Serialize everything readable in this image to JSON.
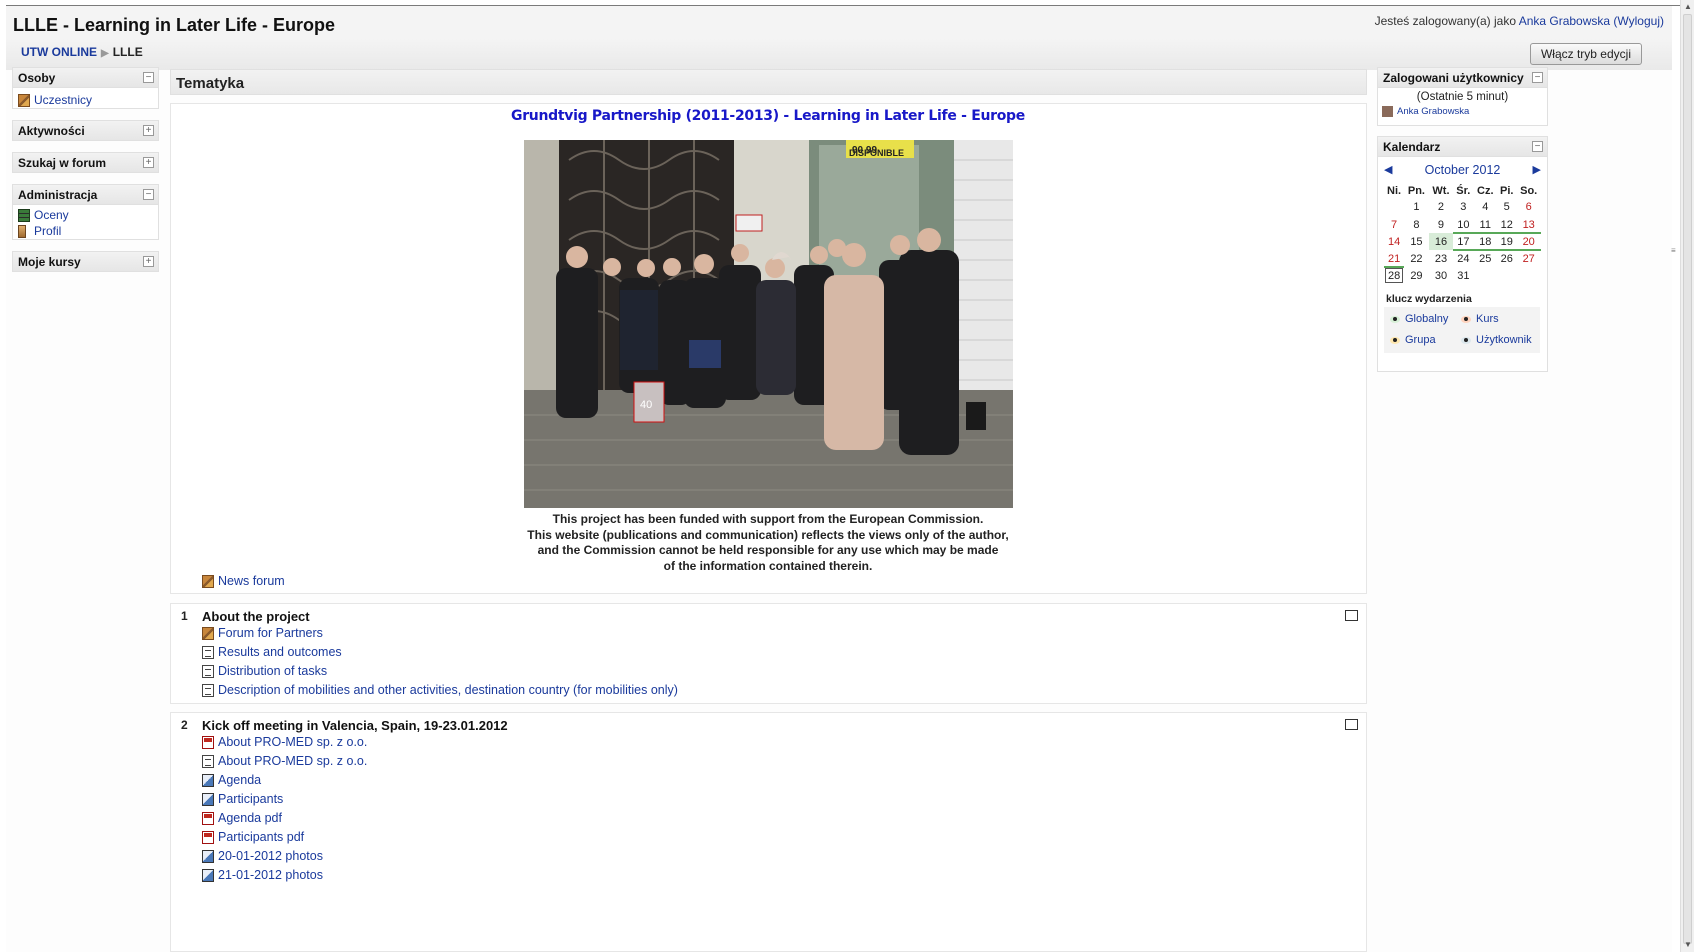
{
  "header": {
    "site_title": "LLLE - Learning in Later Life - Europe",
    "login_prefix": "Jesteś zalogowany(a) jako ",
    "user_name": "Anka Grabowska",
    "logout_label": "(Wyloguj)"
  },
  "breadcrumb": {
    "home": "UTW ONLINE",
    "separator": "▶",
    "current": "LLLE"
  },
  "edit_button": "Włącz tryb edycji",
  "left_blocks": {
    "people": {
      "title": "Osoby",
      "items": [
        "Uczestnicy"
      ]
    },
    "activities": {
      "title": "Aktywności"
    },
    "forum_search": {
      "title": "Szukaj w forum"
    },
    "admin": {
      "title": "Administracja",
      "items": [
        "Oceny",
        "Profil"
      ]
    },
    "courses": {
      "title": "Moje kursy"
    }
  },
  "main": {
    "section_title": "Tematyka",
    "banner": "Grundtvig Partnership (2011-2013) - Learning in Later Life - Europe",
    "disclaimer": [
      "This project has been funded with support from the European Commission.",
      "This website (publications and communication) reflects the views only of the author,",
      "and the Commission cannot be held responsible for any use which may be made",
      "of the information contained therein."
    ],
    "news_forum": "News forum",
    "topics": [
      {
        "number": "1",
        "title": "About the project",
        "activities": [
          {
            "label": "Forum for Partners",
            "icon": "forum-icon"
          },
          {
            "label": "Results and outcomes",
            "icon": "page-icon"
          },
          {
            "label": "Distribution of tasks",
            "icon": "page-icon"
          },
          {
            "label": "Description of mobilities and other activities, destination country (for mobilities only)",
            "icon": "page-icon"
          }
        ]
      },
      {
        "number": "2",
        "title": "Kick off meeting in Valencia, Spain, 19-23.01.2012",
        "activities": [
          {
            "label": "About PRO-MED sp. z o.o.",
            "icon": "pdf-icon"
          },
          {
            "label": "About PRO-MED sp. z o.o.",
            "icon": "page-icon"
          },
          {
            "label": "Agenda",
            "icon": "image-file-icon"
          },
          {
            "label": "Participants",
            "icon": "image-file-icon"
          },
          {
            "label": "Agenda pdf",
            "icon": "pdf-icon"
          },
          {
            "label": "Participants pdf",
            "icon": "pdf-icon"
          },
          {
            "label": "20-01-2012 photos",
            "icon": "image-file-icon"
          },
          {
            "label": "21-01-2012 photos",
            "icon": "image-file-icon"
          }
        ]
      }
    ]
  },
  "photo": {
    "sign_text": "DISPONIBLE",
    "sign_number": "90 99",
    "bag_number": "40"
  },
  "right_blocks": {
    "online_users": {
      "title": "Zalogowani użytkownicy",
      "period": "(Ostatnie 5 minut)",
      "users": [
        "Anka Grabowska"
      ]
    },
    "calendar": {
      "title": "Kalendarz",
      "month": "October 2012",
      "prev": "◀",
      "next": "▶",
      "weekdays": [
        "Ni.",
        "Pn.",
        "Wt.",
        "Śr.",
        "Cz.",
        "Pi.",
        "So."
      ],
      "weeks": [
        [
          "",
          "1",
          "2",
          "3",
          "4",
          "5",
          "6"
        ],
        [
          "7",
          "8",
          "9",
          "10",
          "11",
          "12",
          "13"
        ],
        [
          "14",
          "15",
          "16",
          "17",
          "18",
          "19",
          "20"
        ],
        [
          "21",
          "22",
          "23",
          "24",
          "25",
          "26",
          "27"
        ],
        [
          "28",
          "29",
          "30",
          "31",
          "",
          "",
          ""
        ]
      ],
      "key_title": "klucz wydarzenia",
      "key": [
        "Globalny",
        "Kurs",
        "Grupa",
        "Użytkownik"
      ],
      "colors": {
        "global": "#d6f0d6",
        "course": "#ffd3bd",
        "group": "#fee7ae",
        "user": "#dce7ec",
        "weekend": "#c02020",
        "event_underline": "#58a858"
      }
    }
  },
  "colors": {
    "link": "#1a3a9c",
    "banner": "#1818c8"
  }
}
